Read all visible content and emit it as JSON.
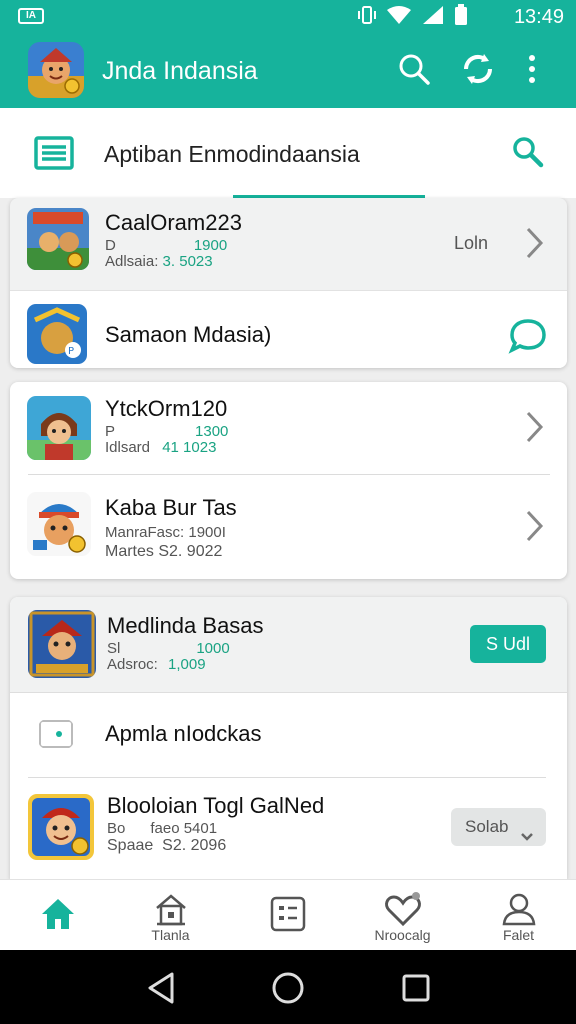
{
  "status_bar": {
    "notification_badge": "IA",
    "time": "13:49"
  },
  "app_bar": {
    "title": "Jnda Indansia",
    "accent": "#16b39c"
  },
  "sub_header": {
    "title": "Aptiban Enmodindaansia"
  },
  "list": {
    "item1": {
      "title": "CaalOram223",
      "line1_a": "D",
      "line1_b": "1900",
      "line2_label": "Adlsaia:",
      "line2_value": "3. 5023",
      "right_label": "Loln"
    },
    "item2": {
      "title": "Samaon Mdasia)"
    },
    "item3": {
      "title": "YtckOrm120",
      "line1_a": "P",
      "line1_b": "1300",
      "line2_label": "Idlsard",
      "line2_value": "41 1023"
    },
    "item4": {
      "title": "Kaba Bur Tas",
      "line1": "ManraFasc: 1900I",
      "line2": "Martes S2. 9022"
    },
    "item5": {
      "title": "Medlinda Basas",
      "line1_a": "Sl",
      "line1_b": "1000",
      "line2_label": "Adsroc:",
      "line2_value": "1,009",
      "button_label": "S Udl"
    },
    "item6": {
      "title": "Apmla nIodckas"
    },
    "item7": {
      "title": "Blooloian Togl GalNed",
      "line1": "Bo      faeo 5401",
      "line2": "Spaae  S2. 2096",
      "select_label": "Solab"
    }
  },
  "bottom_nav": {
    "items": [
      {
        "label": ""
      },
      {
        "label": "Tlanla"
      },
      {
        "label": ""
      },
      {
        "label": "Nroocalg"
      },
      {
        "label": "Falet"
      }
    ]
  }
}
